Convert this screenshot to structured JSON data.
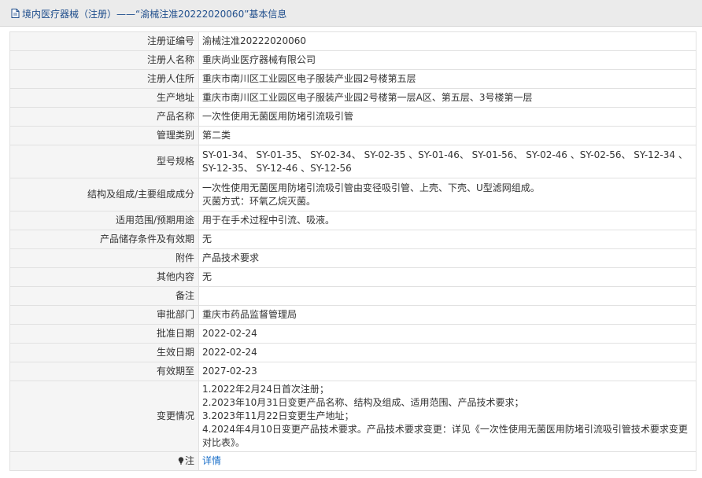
{
  "header": {
    "title": "境内医疗器械（注册）——“渝械注准20222020060”基本信息",
    "icon": "document-icon"
  },
  "rows": [
    {
      "label": "注册证编号",
      "value": "渝械注准20222020060"
    },
    {
      "label": "注册人名称",
      "value": "重庆尚业医疗器械有限公司"
    },
    {
      "label": "注册人住所",
      "value": "重庆市南川区工业园区电子服装产业园2号楼第五层"
    },
    {
      "label": "生产地址",
      "value": "重庆市南川区工业园区电子服装产业园2号楼第一层A区、第五层、3号楼第一层"
    },
    {
      "label": "产品名称",
      "value": "一次性使用无菌医用防堵引流吸引管"
    },
    {
      "label": "管理类别",
      "value": "第二类"
    },
    {
      "label": "型号规格",
      "value": "SY-01-34、 SY-01-35、 SY-02-34、 SY-02-35 、SY-01-46、 SY-01-56、 SY-02-46 、SY-02-56、 SY-12-34 、SY-12-35、 SY-12-46 、SY-12-56"
    },
    {
      "label": "结构及组成/主要组成成分",
      "lines": [
        "一次性使用无菌医用防堵引流吸引管由变径吸引管、上壳、下壳、U型滤网组成。",
        "灭菌方式：环氧乙烷灭菌。"
      ]
    },
    {
      "label": "适用范围/预期用途",
      "value": "用于在手术过程中引流、吸液。"
    },
    {
      "label": "产品储存条件及有效期",
      "value": "无"
    },
    {
      "label": "附件",
      "value": "产品技术要求"
    },
    {
      "label": "其他内容",
      "value": "无"
    },
    {
      "label": "备注",
      "value": ""
    },
    {
      "label": "审批部门",
      "value": "重庆市药品监督管理局"
    },
    {
      "label": "批准日期",
      "value": "2022-02-24"
    },
    {
      "label": "生效日期",
      "value": "2022-02-24"
    },
    {
      "label": "有效期至",
      "value": "2027-02-23"
    },
    {
      "label": "变更情况",
      "lines": [
        "1.2022年2月24日首次注册；",
        "2.2023年10月31日变更产品名称、结构及组成、适用范围、产品技术要求；",
        "3.2023年11月22日变更生产地址；",
        "4.2024年4月10日变更产品技术要求。产品技术要求变更：详见《一次性使用无菌医用防堵引流吸引管技术要求变更对比表》。"
      ]
    }
  ],
  "note_row": {
    "label": "注",
    "icon": "lightbulb-icon",
    "link": "详情"
  }
}
